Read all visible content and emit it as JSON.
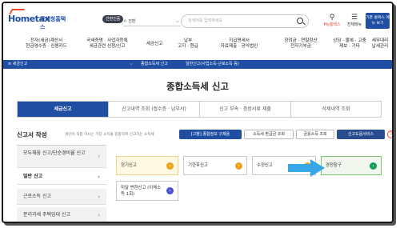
{
  "header": {
    "logo_brand": "Hometax",
    "logo_sub": "국세청홈택스",
    "login_label": "간편인증",
    "select_value": "ㅇ 전환",
    "search_placeholder": "검색어를 입력하세요",
    "myhome_label": "My홈택스",
    "allmenu_label": "전체메뉴",
    "bigbtn_label": "기존 홈택스 메뉴 보기"
  },
  "gnb": [
    {
      "line1": "전자(세금)계산서",
      "line2": "현금영수증 · 신용카드"
    },
    {
      "line1": "국세증명 · 사업자등록",
      "line2": "세금관련 신청/신고"
    },
    {
      "line1": "세금신고",
      "line2": ""
    },
    {
      "line1": "납부",
      "line2": "고지 · 환급"
    },
    {
      "line1": "지급명세서",
      "line2": "자료제출 · 공익법인"
    },
    {
      "line1": "장려금 · 연말정산",
      "line2": "전자기부금"
    },
    {
      "line1": "상담 · 불복 · 고충",
      "line2": "제보 · 기타"
    },
    {
      "line1": "세무대리",
      "line2": "납세관리"
    }
  ],
  "bluebar": {
    "home": "≡ 세금신고",
    "crumb1": "종합소득세 신고",
    "crumb2": "일반신고(사업소득·근로소득 등)"
  },
  "page_title": "종합소득세 신고",
  "tabs": [
    "세금신고",
    "신고내역 조회 (접수증 · 납부서)",
    "신고 부속 · 증빙서류 제출",
    "삭제내역 조회"
  ],
  "subheader": {
    "title": "신고서 작성",
    "note": "개인이 직접 하시는 가장 소득을 종합하여 신고하는 소득세",
    "btn1": "[고향] 종합정보 구제용",
    "btn2": "소득세 환급금 조회",
    "btn3": "금융소득 조회",
    "btn4": "신고도움서비스",
    "help": "?"
  },
  "sidebar": [
    {
      "label": "모두채움 신고/단순경비율 신고"
    },
    {
      "label": "일반 신고"
    },
    {
      "label": "근로소득 신고"
    },
    {
      "label": "분리과세 주택임대 신고"
    }
  ],
  "cards": [
    {
      "label": "정기신고"
    },
    {
      "label": "기한후신고"
    },
    {
      "label": "수정신고"
    },
    {
      "label": "경정청구"
    },
    {
      "label": "미달 변환신고 (이체소득 1회)"
    }
  ],
  "colors": {
    "accent": "#1f4ea3",
    "arrow": "#38a7e8",
    "brand_red": "#e8462d"
  }
}
